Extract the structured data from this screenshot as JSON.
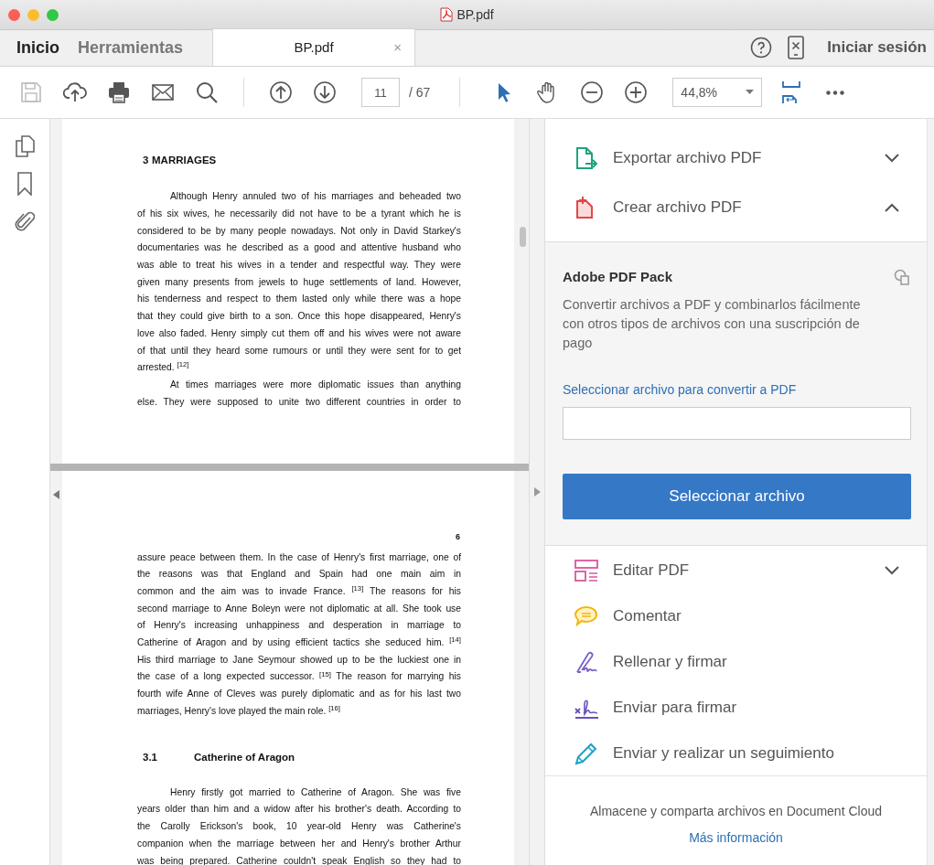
{
  "window": {
    "title": "BP.pdf"
  },
  "tabs": [
    {
      "label": "Inicio",
      "selected": false
    },
    {
      "label": "Herramientas",
      "selected": false
    },
    {
      "label": "BP.pdf",
      "selected": true,
      "close": "×"
    }
  ],
  "header_right": {
    "sign_in": "Iniciar sesión"
  },
  "toolbar": {
    "save_disabled": true,
    "page_number": "11",
    "page_count": "/ 67",
    "zoom": "44,8%",
    "select_tool_selected": true
  },
  "document": {
    "pages": [
      {
        "blocks": [
          {
            "kind": "heading",
            "number": "3",
            "title": "MARRIAGES"
          },
          {
            "kind": "paragraph",
            "indent": true,
            "continues": false,
            "lines": [
              "Although Henry annuled two of his marriages and beheaded two",
              "of his six wives, he necessarily did not have to be a tyrant which he is",
              "considered to be by many people nowadays. Not only in David Starkey's",
              "documentaries was he described as a good and attentive husband who",
              "was able to treat his wives in a tender and respectful way. They were",
              "given many presents from jewels to huge settlements of land. However,",
              "his tenderness and respect to them lasted only while there was a hope",
              "that they could give birth to a son. Once this hope disappeared, Henry's",
              "love also faded. Henry simply cut them off and his wives were not aware",
              "of that until they heard some rumours or until they were sent for to get",
              "arrested. $^{[12]}$"
            ]
          },
          {
            "kind": "paragraph",
            "indent": true,
            "continues": true,
            "lines": [
              "At times marriages were more diplomatic issues than anything",
              "else. They were supposed to unite two different countries in order to"
            ]
          }
        ]
      },
      {
        "page_label": "6",
        "blocks": [
          {
            "kind": "paragraph",
            "indent": false,
            "continues": false,
            "lines": [
              "assure peace between them. In the case of Henry's first marriage, one of",
              "the reasons was that England and Spain had one main aim in",
              "common and the aim was to invade France. $^{[13]}$ The reasons for his",
              "second marriage to Anne Boleyn were not diplomatic at all. She took use",
              "of Henry's increasing unhappiness and desperation in marriage to",
              "Catherine of Aragon and by using efficient tactics she seduced him. $^{[14]}$",
              "His third marriage to Jane Seymour showed up to be the luckiest one in",
              "the case of a long expected successor. $^{[15]}$ The reason for marrying his",
              "fourth wife Anne of Cleves was purely diplomatic and as for his last two",
              "marriages, Henry's love played the main role. $^{[16]}$"
            ]
          },
          {
            "kind": "subheading",
            "number": "3.1",
            "title": "Catherine of Aragon"
          },
          {
            "kind": "paragraph",
            "indent": true,
            "continues": true,
            "lines": [
              "Henry firstly got married to Catherine of Aragon. She was five",
              "years older than him and a widow after his brother's death. According to",
              "the Carolly Erickson's book, 10 year-old Henry was Catherine's",
              "companion when the marriage between her and Henry's brother Arthur",
              "was being prepared. Catherine couldn't speak English so they had to"
            ]
          }
        ]
      }
    ]
  },
  "tools": [
    {
      "label": "Exportar archivo PDF",
      "expandable": true,
      "expanded": false
    },
    {
      "label": "Crear archivo PDF",
      "expandable": true,
      "expanded": true,
      "panel": {
        "title": "Adobe PDF Pack",
        "description": "Convertir archivos a PDF y combinarlos fácilmente con otros tipos de archivos con una suscripción de pago",
        "field_label": "Seleccionar archivo para convertir a PDF",
        "button": "Seleccionar archivo"
      }
    },
    {
      "label": "Editar PDF",
      "expandable": true,
      "expanded": false
    },
    {
      "label": "Comentar",
      "expandable": false,
      "expanded": false
    },
    {
      "label": "Rellenar y firmar",
      "expandable": false,
      "expanded": false
    },
    {
      "label": "Enviar para firmar",
      "expandable": false,
      "expanded": false
    },
    {
      "label": "Enviar y realizar un seguimiento",
      "expandable": false,
      "expanded": false
    }
  ],
  "footer": {
    "text": "Almacene y comparta archivos en Document Cloud",
    "link": "Más información"
  }
}
